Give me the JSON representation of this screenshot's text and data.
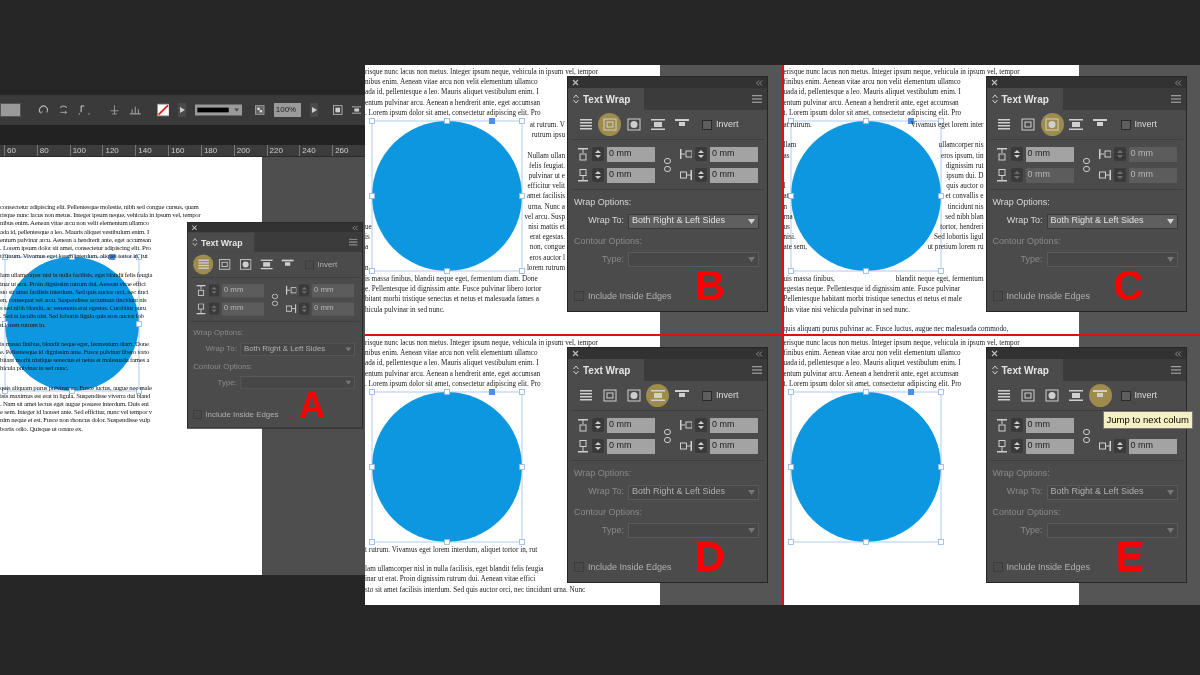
{
  "views": [
    {
      "letter": "A",
      "kind": "editor",
      "toolbar": {
        "zoom": "100%"
      },
      "ruler": [
        "60",
        "80",
        "100",
        "120",
        "140",
        "160",
        "180",
        "200",
        "220",
        "240",
        "260"
      ],
      "paragraphs": [
        [
          {
            "left": "consectetur adipiscing elit. Pellentesque molestie, nibh sed congue cursus, quam"
          },
          {
            "left": "risque nunc lacus non metus. Integer ipsum neque, vehicula in ipsum vel, tempor"
          },
          {
            "left": "nibus enim. Aenean vitae arcu non velit elementum ullamco"
          },
          {
            "left": "ada id, pellentesque a leo. Mauris aliquet vestibulum enim. I"
          },
          {
            "left": "entum pulvinar arcu. Aenean a hendrerit ante, eget accumsan"
          },
          {
            "left": ". Lorem ipsum dolor sit amet, consectetur adipiscing elit. Pro"
          },
          {
            "left": "t rutrum. Vivamus eget lorem interdum, aliquet tortor in, rut"
          }
        ],
        [
          {
            "left": "lam ullamcorper nisl in nulla facilisis, eget blandit felis feugia"
          },
          {
            "left": "inar ut erat. Proin dignissim rutrum dui. Aenean vitae effici"
          },
          {
            "left": "sto sit amet facilisis interdum. Sed quis auctor orci, nec tinci"
          },
          {
            "left": "en, consequat vel arcu. Suspendisse accumsan tincidunt nis"
          },
          {
            "left": "s sed nibh blandit, ac venenatis erat egestas. Curabitur puru"
          },
          {
            "left": ". Sed at iaculis nisi. Sed lobortis ligula quis eros auctor lob"
          },
          {
            "left": "n lorem rutrum in."
          }
        ],
        [
          {
            "left": "is massa finibus, blandit neque eget, fermentum diam. Done"
          },
          {
            "left": "e. Pellentesque id dignissim ante. Fusce pulvinar libero torto"
          },
          {
            "left": "bitant morbi tristique senectus et netus et malesuada fames a"
          },
          {
            "left": "hicula pulvinar in sed nunc."
          }
        ],
        [
          {
            "left": "quis aliquam purus pulvinar ac. Fusce luctus, augue nec male"
          },
          {
            "left": "isis maximus est erat in ligula. Suspendisse viverra dui bland"
          },
          {
            "left": ". Nam sit amet lectus eget augue posuere interdum. Duis eni"
          },
          {
            "left": "e sem. Integer id laoreet ante. Sed efficitur, nunc vel tempor v"
          },
          {
            "left": "nim neque et est. Fusce non rhoncus dolor. Suspendisse vulp"
          },
          {
            "left": "bortis odio. Quisque ut ornare ex."
          }
        ]
      ],
      "panel": {
        "title": "Text Wrap",
        "wrap_modes": [
          {
            "kind": "no_wrap",
            "selected": true
          },
          {
            "kind": "bounding_box",
            "selected": false
          },
          {
            "kind": "object_shape",
            "selected": false
          },
          {
            "kind": "jump_object",
            "selected": false
          },
          {
            "kind": "jump_column",
            "selected": false
          }
        ],
        "invert": {
          "label": "Invert",
          "checked": false,
          "disabled": true
        },
        "fields": [
          {
            "value": "0 mm",
            "disabled": true
          },
          {
            "value": "0 mm",
            "disabled": true
          },
          {
            "value": "0 mm",
            "disabled": true
          },
          {
            "value": "0 mm",
            "disabled": true
          }
        ],
        "wrap_options": {
          "label": "Wrap Options:",
          "wrap_to_label": "Wrap To:",
          "wrap_to": "Both Right & Left Sides",
          "disabled": true
        },
        "contour_options": {
          "label": "Contour Options:",
          "type_label": "Type:",
          "disabled": true
        },
        "include_inside_edges": {
          "label": "Include Inside Edges",
          "checked": false,
          "disabled": true
        }
      }
    },
    {
      "letter": "B",
      "kind": "quadrant",
      "top": [
        [
          {
            "left": "risque nunc lacus non metus. Integer ipsum neque, vehicula in ipsum vel, tempor"
          },
          {
            "left": "nibus enim. Aenean vitae arcu non velit elementum ullamco"
          },
          {
            "left": "ada id, pellentesque a leo. Mauris aliquet vestibulum enim. I"
          },
          {
            "left": "entum pulvinar arcu. Aenean a hendrerit ante, eget accumsan"
          },
          {
            "left": ". Lorem ipsum dolor sit amet, consectetur adipiscing elit. Pro"
          }
        ]
      ],
      "side": [
        [
          {
            "right": "at rutrum. V"
          },
          {
            "right": "rutrum ipsu"
          }
        ],
        [
          {
            "right": "Nullam ullan"
          },
          {
            "right": "felis feugiat."
          },
          {
            "right": "pulvinar ut e"
          },
          {
            "right": "efficitur velit"
          },
          {
            "right": "amet facilisis"
          },
          {
            "right": "urna. Nunc a"
          },
          {
            "right": "vel arcu. Susp"
          },
          {
            "left": "ue",
            "right": "nisi mattis et"
          },
          {
            "left": "is",
            "right": "erat egestas."
          },
          {
            "left": "a",
            "right": "non, congue"
          },
          {
            "right": "eros auctor l"
          },
          {
            "left": "n",
            "right": "lorem rutrum"
          }
        ]
      ],
      "bottom": [
        [
          {
            "left": "is massa finibus, blandit neque eget, fermentum diam. Done"
          },
          {
            "left": "e. Pellentesque id dignissim ante. Fusce pulvinar libero tortor"
          },
          {
            "left": "bitant morbi tristique senectus et netus et malesuada fames a"
          },
          {
            "left": "hicula pulvinar in sed nunc."
          }
        ]
      ],
      "panel": {
        "title": "Text Wrap",
        "wrap_modes": [
          {
            "kind": "no_wrap",
            "selected": false
          },
          {
            "kind": "bounding_box",
            "selected": true
          },
          {
            "kind": "object_shape",
            "selected": false
          },
          {
            "kind": "jump_object",
            "selected": false
          },
          {
            "kind": "jump_column",
            "selected": false
          }
        ],
        "invert": {
          "label": "Invert",
          "checked": false,
          "disabled": false
        },
        "fields": [
          {
            "value": "0 mm",
            "disabled": false
          },
          {
            "value": "0 mm",
            "disabled": false
          },
          {
            "value": "0 mm",
            "disabled": false
          },
          {
            "value": "0 mm",
            "disabled": false
          }
        ],
        "wrap_options": {
          "label": "Wrap Options:",
          "wrap_to_label": "Wrap To:",
          "wrap_to": "Both Right & Left Sides",
          "disabled": false
        },
        "contour_options": {
          "label": "Contour Options:",
          "type_label": "Type:",
          "disabled": true
        },
        "include_inside_edges": {
          "label": "Include Inside Edges",
          "checked": false,
          "disabled": true
        }
      }
    },
    {
      "letter": "C",
      "kind": "quadrant",
      "top": [
        [
          {
            "left": "erisque nunc lacus non metus. Integer ipsum neque, vehicula in ipsum vel, tempor"
          },
          {
            "left": "finibus enim. Aenean vitae arcu non velit elementum ullamco"
          },
          {
            "left": "uada id, pellentesque a leo. Mauris aliquet vestibulum enim. I"
          },
          {
            "left": "entum pulvinar arcu. Aenean a hendrerit ante, eget accumsan"
          },
          {
            "left": "t. Lorem ipsum dolor sit amet, consectetur adipiscing elit. Pro"
          }
        ]
      ],
      "side": [
        [
          {
            "left": "at rutrum.",
            "right": "Vivamus eget lorem inter"
          }
        ],
        [
          {
            "left": "llam",
            "right": "ullamcorper nis"
          },
          {
            "left": "as",
            "right": "eros ipsum, tin"
          },
          {
            "right": "dignissim rut"
          },
          {
            "right": "ipsum dui. D"
          },
          {
            "left": "l",
            "right": "quis auctor o"
          },
          {
            "left": "at",
            "right": "et convallis e"
          },
          {
            "left": "n",
            "right": "tincidunt nis"
          },
          {
            "left": "rna",
            "right": "sed nibh blan"
          },
          {
            "left": "us",
            "right": "tortor, hendreri"
          },
          {
            "left": "nisi.",
            "right": "Sed lobortis ligul"
          },
          {
            "left": "ate sem,",
            "right": "ut pretium lorem ru"
          }
        ]
      ],
      "bottom": [
        [
          {
            "left": "uis massa finibus,",
            "right": "blandit neque eget, fermentum"
          },
          {
            "left": "egestas neque. Pellentesque id dignissim ante. Fusce pulvinar"
          },
          {
            "left": "Pellentesque habitant morbi tristique senectus et netus et male"
          },
          {
            "left": "llus vitae nisi vehicula pulvinar in sed nunc."
          }
        ],
        [
          {
            "left": "quis aliquam purus pulvinar ac. Fusce luctus, augue nec malesuada commodo,"
          }
        ]
      ],
      "panel": {
        "title": "Text Wrap",
        "wrap_modes": [
          {
            "kind": "no_wrap",
            "selected": false
          },
          {
            "kind": "bounding_box",
            "selected": false
          },
          {
            "kind": "object_shape",
            "selected": true
          },
          {
            "kind": "jump_object",
            "selected": false
          },
          {
            "kind": "jump_column",
            "selected": false
          }
        ],
        "invert": {
          "label": "Invert",
          "checked": false,
          "disabled": false
        },
        "fields": [
          {
            "value": "0 mm",
            "disabled": false
          },
          {
            "value": "0 mm",
            "disabled": true
          },
          {
            "value": "0 mm",
            "disabled": true
          },
          {
            "value": "0 mm",
            "disabled": true
          }
        ],
        "wrap_options": {
          "label": "Wrap Options:",
          "wrap_to_label": "Wrap To:",
          "wrap_to": "Both Right & Left Sides",
          "disabled": false
        },
        "contour_options": {
          "label": "Contour Options:",
          "type_label": "Type:",
          "disabled": true
        },
        "include_inside_edges": {
          "label": "Include Inside Edges",
          "checked": false,
          "disabled": true
        }
      }
    },
    {
      "letter": "D",
      "kind": "quadrant",
      "top": [
        [
          {
            "left": "risque nunc lacus non metus. Integer ipsum neque, vehicula in ipsum vel, tempor"
          },
          {
            "left": "nibus enim. Aenean vitae arcu non velit elementum ullamco"
          },
          {
            "left": "ada id, pellentesque a leo. Mauris aliquet vestibulum enim. I"
          },
          {
            "left": "entum pulvinar arcu. Aenean a hendrerit ante, eget accumsan"
          },
          {
            "left": ". Lorem ipsum dolor sit amet, consectetur adipiscing elit. Pro"
          }
        ]
      ],
      "bottom": [
        [
          {
            "left": "t rutrum. Vivamus eget lorem interdum, aliquet tortor in, rut"
          }
        ],
        [
          {
            "left": "lam ullamcorper nisl in nulla facilisis, eget blandit felis feugia"
          },
          {
            "left": "inar ut erat. Proin dignissim rutrum dui. Aenean vitae effici"
          },
          {
            "left": "sto sit amet facilisis interdum. Sed quis auctor orci, nec tincidunt urna. Nunc"
          }
        ]
      ],
      "panel": {
        "title": "Text Wrap",
        "wrap_modes": [
          {
            "kind": "no_wrap",
            "selected": false
          },
          {
            "kind": "bounding_box",
            "selected": false
          },
          {
            "kind": "object_shape",
            "selected": false
          },
          {
            "kind": "jump_object",
            "selected": true
          },
          {
            "kind": "jump_column",
            "selected": false
          }
        ],
        "invert": {
          "label": "Invert",
          "checked": false,
          "disabled": false
        },
        "fields": [
          {
            "value": "0 mm",
            "disabled": false
          },
          {
            "value": "0 mm",
            "disabled": false
          },
          {
            "value": "0 mm",
            "disabled": false
          },
          {
            "value": "0 mm",
            "disabled": false
          }
        ],
        "wrap_options": {
          "label": "Wrap Options:",
          "wrap_to_label": "Wrap To:",
          "wrap_to": "Both Right & Left Sides",
          "disabled": true
        },
        "contour_options": {
          "label": "Contour Options:",
          "type_label": "Type:",
          "disabled": true
        },
        "include_inside_edges": {
          "label": "Include Inside Edges",
          "checked": false,
          "disabled": true
        }
      }
    },
    {
      "letter": "E",
      "kind": "quadrant",
      "top": [
        [
          {
            "left": "erisque nunc lacus non metus. Integer ipsum neque, vehicula in ipsum vel, tempor"
          },
          {
            "left": "finibus enim. Aenean vitae arcu non velit elementum ullamco"
          },
          {
            "left": "uada id, pellentesque a leo. Mauris aliquet vestibulum enim. I"
          },
          {
            "left": "entum pulvinar arcu. Aenean a hendrerit ante, eget accumsan"
          },
          {
            "left": "t. Lorem ipsum dolor sit amet, consectetur adipiscing elit. Pro"
          }
        ]
      ],
      "panel": {
        "title": "Text Wrap",
        "wrap_modes": [
          {
            "kind": "no_wrap",
            "selected": false
          },
          {
            "kind": "bounding_box",
            "selected": false
          },
          {
            "kind": "object_shape",
            "selected": false
          },
          {
            "kind": "jump_object",
            "selected": false
          },
          {
            "kind": "jump_column",
            "selected": true
          }
        ],
        "invert": {
          "label": "Invert",
          "checked": false,
          "disabled": false
        },
        "fields": [
          {
            "value": "0 mm",
            "disabled": false
          },
          {
            "value": "0 mm",
            "disabled": false
          },
          {
            "covered": true
          },
          {
            "value": "0 mm",
            "disabled": false
          }
        ],
        "wrap_options": {
          "label": "Wrap Options:",
          "wrap_to_label": "Wrap To:",
          "wrap_to": "Both Right & Left Sides",
          "disabled": true
        },
        "contour_options": {
          "label": "Contour Options:",
          "type_label": "Type:",
          "disabled": true
        },
        "include_inside_edges": {
          "label": "Include Inside Edges",
          "checked": false,
          "disabled": true
        },
        "tooltip": "Jump to next colum"
      }
    }
  ]
}
